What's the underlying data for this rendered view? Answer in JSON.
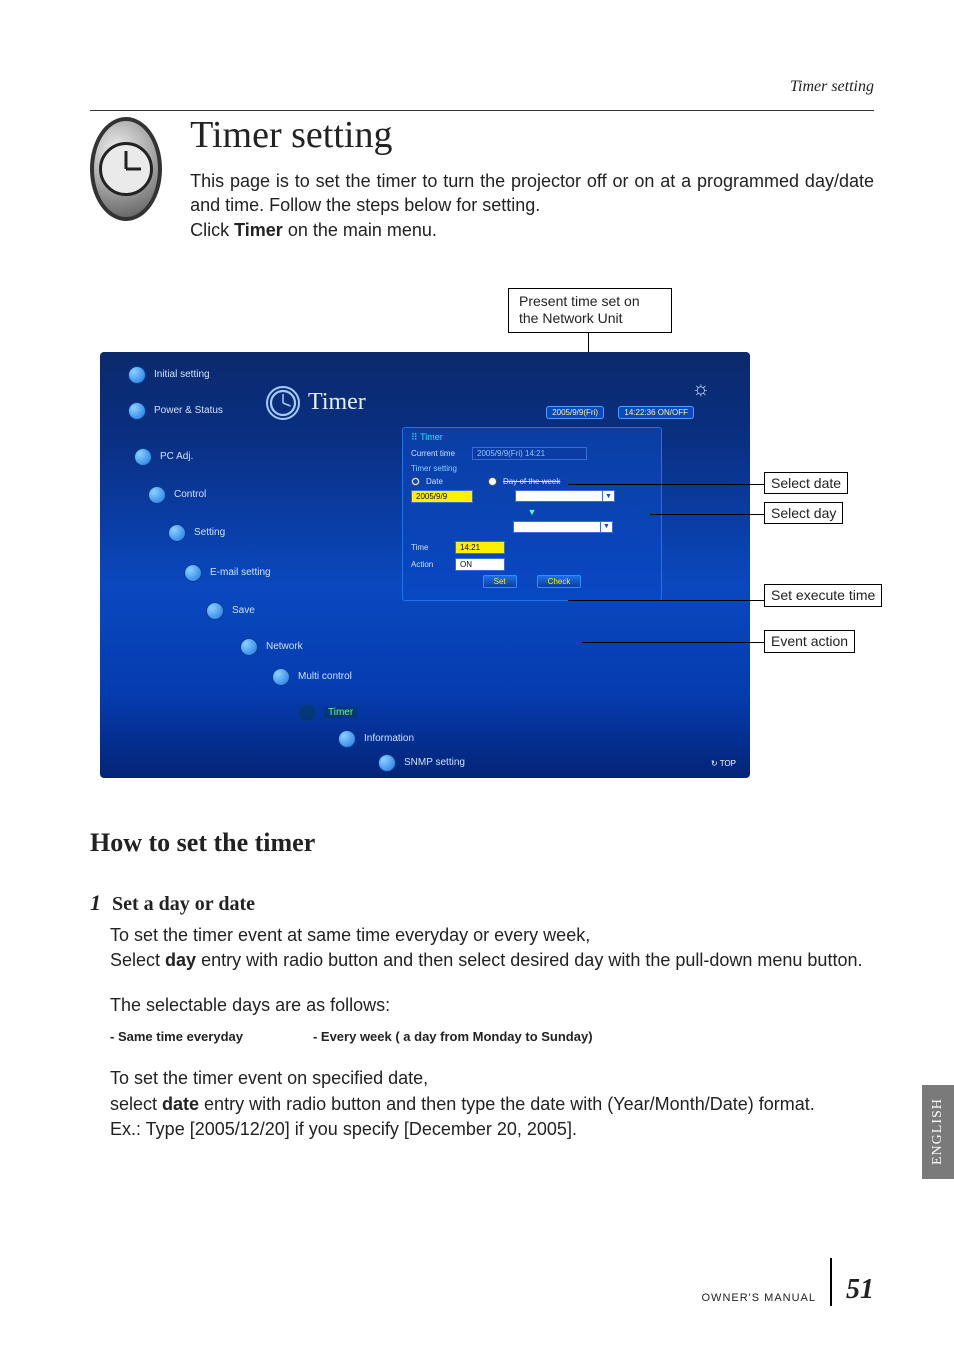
{
  "header": {
    "breadcrumb": "Timer setting"
  },
  "title": "Timer setting",
  "intro_1": "This page is to set the timer to turn the projector off or on at a programmed day/date and time. Follow the steps below for setting.",
  "intro_2_a": "Click ",
  "intro_2_b": "Timer",
  "intro_2_c": " on the main menu.",
  "callouts": {
    "top": "Present time set on the Network Unit",
    "select_date": "Select date",
    "select_day": "Select day",
    "set_time": "Set execute time",
    "event_action": "Event action"
  },
  "app": {
    "title": "Timer",
    "status_date": "2005/9/9(Fri)",
    "status_time": "14:22:36  ON/OFF",
    "nav": {
      "initial": "Initial setting",
      "power": "Power & Status",
      "pcadj": "PC Adj.",
      "control": "Control",
      "setting": "Setting",
      "email": "E-mail setting",
      "save": "Save",
      "network": "Network",
      "multi": "Multi control",
      "timer": "Timer",
      "info": "Information",
      "snmp": "SNMP setting"
    },
    "panel": {
      "head": "Timer",
      "current_label": "Current time",
      "current_value": "2005/9/9(Fri) 14:21",
      "timer_setting_label": "Timer setting",
      "date_label": "Date",
      "day_label": "Day of the week",
      "date_value": "2005/9/9",
      "time_label": "Time",
      "time_value": "14:21",
      "action_label": "Action",
      "action_value": "ON",
      "set_btn": "Set",
      "check_btn": "Check"
    },
    "top_link": "TOP"
  },
  "section_heading": "How to set the timer",
  "step1": {
    "number": "1",
    "title": "Set a day or date",
    "line1": "To set the timer event at same time everyday or every week,",
    "line2_a": "Select ",
    "line2_b": "day",
    "line2_c": " entry with radio button and then select desired day with the pull-down menu button.",
    "line3": "The selectable days are as follows:",
    "opt1": "- Same time everyday",
    "opt2": "- Every week ( a day from Monday to Sunday)",
    "line4": "To set the timer event on specified date,",
    "line5_a": "select ",
    "line5_b": "date",
    "line5_c": " entry with radio button and then type the date with (Year/Month/Date) format.",
    "line6": "Ex.: Type [2005/12/20] if you specify [December 20, 2005]."
  },
  "lang_tab": "ENGLISH",
  "footer": {
    "page": "51",
    "label": "OWNER'S MANUAL"
  }
}
